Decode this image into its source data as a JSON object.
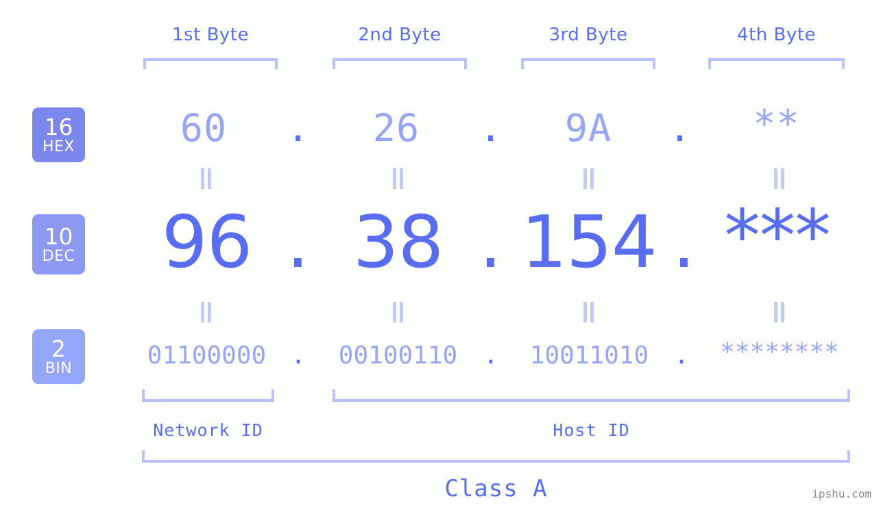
{
  "background_color": "#fdfffc",
  "accent_color": "#5a6df0",
  "accent_light_color": "#98a4f5",
  "bracket_color": "#b9c2fb",
  "byte_headers": [
    {
      "label": "1st Byte"
    },
    {
      "label": "2nd Byte"
    },
    {
      "label": "3rd Byte"
    },
    {
      "label": "4th Byte"
    }
  ],
  "rows": [
    {
      "base_number": "16",
      "base_name": "HEX",
      "badge_color": "#7b87ed",
      "values": [
        "60",
        "26",
        "9A",
        "**"
      ],
      "separator": "."
    },
    {
      "base_number": "10",
      "base_name": "DEC",
      "badge_color": "#8c98f2",
      "values": [
        "96",
        "38",
        "154",
        "***"
      ],
      "separator": "."
    },
    {
      "base_number": "2",
      "base_name": "BIN",
      "badge_color": "#93a6f8",
      "values": [
        "01100000",
        "00100110",
        "10011010",
        "********"
      ],
      "separator": "."
    }
  ],
  "sections": [
    {
      "label": "Network ID"
    },
    {
      "label": "Host ID"
    }
  ],
  "class_label": "Class A",
  "watermark": "ipshu.com",
  "chart_data": {
    "type": "table",
    "title": "IP Address Byte Breakdown",
    "columns": [
      "1st Byte",
      "2nd Byte",
      "3rd Byte",
      "4th Byte"
    ],
    "rows": [
      {
        "base": "16 HEX",
        "cells": [
          "60",
          "26",
          "9A",
          "**"
        ]
      },
      {
        "base": "10 DEC",
        "cells": [
          "96",
          "38",
          "154",
          "***"
        ]
      },
      {
        "base": "2 BIN",
        "cells": [
          "01100000",
          "00100110",
          "10011010",
          "********"
        ]
      }
    ],
    "network_id_bytes": 1,
    "host_id_bytes": 3,
    "address_class": "Class A"
  }
}
